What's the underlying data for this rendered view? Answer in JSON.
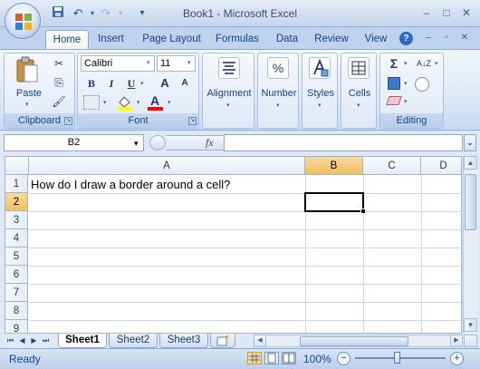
{
  "window": {
    "title": "Book1 - Microsoft Excel",
    "minimize": "–",
    "maximize": "□",
    "close": "✕",
    "ribbon_minimize": "–",
    "ribbon_restore": "▫",
    "ribbon_close": "✕"
  },
  "quick_access": {
    "save": "💾",
    "undo": "↶",
    "redo": "↷",
    "customize": "▾"
  },
  "tabs": [
    "Home",
    "Insert",
    "Page Layout",
    "Formulas",
    "Data",
    "Review",
    "View"
  ],
  "help": "?",
  "ribbon": {
    "clipboard": {
      "label": "Clipboard",
      "paste": "Paste",
      "cut": "✂",
      "copy": "⎘",
      "format_painter": "🖌"
    },
    "font": {
      "label": "Font",
      "name": "Calibri",
      "size": "11",
      "bold": "B",
      "italic": "I",
      "underline": "U",
      "grow": "A",
      "shrink": "A",
      "font_color_letter": "A",
      "font_color": "#ff0000",
      "fill_color": "#ffff00"
    },
    "alignment": {
      "label": "Alignment"
    },
    "number": {
      "label": "Number",
      "icon": "%"
    },
    "styles": {
      "label": "Styles"
    },
    "cells": {
      "label": "Cells"
    },
    "editing": {
      "label": "Editing",
      "sum": "Σ",
      "sort": "A↓Z"
    }
  },
  "formula_bar": {
    "name_box": "B2",
    "fx": "fx",
    "value": ""
  },
  "grid": {
    "columns": [
      "A",
      "B",
      "C",
      "D"
    ],
    "selected_column": "B",
    "rows": [
      "1",
      "2",
      "3",
      "4",
      "5",
      "6",
      "7",
      "8",
      "9"
    ],
    "selected_row": "2",
    "cells": {
      "A1": "How do I draw a border around a cell?"
    }
  },
  "sheets": [
    "Sheet1",
    "Sheet2",
    "Sheet3"
  ],
  "active_sheet": "Sheet1",
  "nav": [
    "⏮",
    "◀",
    "▶",
    "⏭"
  ],
  "status": {
    "text": "Ready",
    "zoom": "100%",
    "zoom_out": "−",
    "zoom_in": "+"
  },
  "colors": {
    "accent": "#15428b",
    "selection_header": "#f1c15f"
  }
}
